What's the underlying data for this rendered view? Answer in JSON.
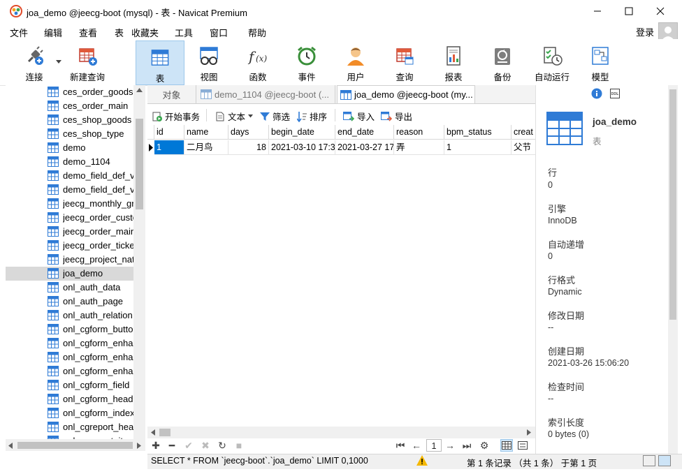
{
  "window": {
    "title": "joa_demo @jeecg-boot (mysql) - 表 - Navicat Premium",
    "min_icon": "minimize-icon",
    "max_icon": "maximize-icon",
    "close_icon": "close-icon"
  },
  "menu": {
    "items": [
      "文件",
      "编辑",
      "查看",
      "表",
      "收藏夹",
      "工具",
      "窗口",
      "帮助"
    ],
    "login": "登录"
  },
  "toolbar": {
    "buttons": [
      {
        "label": "连接",
        "icon": "plug-icon"
      },
      {
        "label": "新建查询",
        "icon": "new-query-icon"
      },
      {
        "label": "表",
        "icon": "table-icon"
      },
      {
        "label": "视图",
        "icon": "view-glasses-icon"
      },
      {
        "label": "函数",
        "icon": "function-icon"
      },
      {
        "label": "事件",
        "icon": "alarm-clock-icon"
      },
      {
        "label": "用户",
        "icon": "user-icon"
      },
      {
        "label": "查询",
        "icon": "query-grid-icon"
      },
      {
        "label": "报表",
        "icon": "report-icon"
      },
      {
        "label": "备份",
        "icon": "backup-icon"
      },
      {
        "label": "自动运行",
        "icon": "schedule-icon"
      },
      {
        "label": "模型",
        "icon": "model-icon"
      }
    ],
    "active_index": 2
  },
  "tree": {
    "items": [
      "ces_order_goods",
      "ces_order_main",
      "ces_shop_goods",
      "ces_shop_type",
      "demo",
      "demo_1104",
      "demo_field_def_va",
      "demo_field_def_v",
      "jeecg_monthly_gr",
      "jeecg_order_custo",
      "jeecg_order_main",
      "jeecg_order_ticke",
      "jeecg_project_nat",
      "joa_demo",
      "onl_auth_data",
      "onl_auth_page",
      "onl_auth_relation",
      "onl_cgform_butto",
      "onl_cgform_enhar",
      "onl_cgform_enhar",
      "onl_cgform_enhar",
      "onl_cgform_field",
      "onl_cgform_head",
      "onl_cgform_index",
      "onl_cgreport_hea",
      "onl_cgreport_item"
    ],
    "selected_index": 13
  },
  "tabs": [
    {
      "label": "对象"
    },
    {
      "label": "demo_1104 @jeecg-boot (..."
    },
    {
      "label": "joa_demo @jeecg-boot (my..."
    }
  ],
  "datatools": {
    "begin_tx": "开始事务",
    "text": "文本",
    "filter": "筛选",
    "sort": "排序",
    "import": "导入",
    "export": "导出"
  },
  "grid": {
    "columns": [
      "id",
      "name",
      "days",
      "begin_date",
      "end_date",
      "reason",
      "bpm_status",
      "creat"
    ],
    "rows": [
      [
        "1",
        "二月鸟",
        "18",
        "2021-03-10 17:3",
        "2021-03-27 17",
        "弄",
        "1",
        "父节"
      ]
    ]
  },
  "nav": {
    "page": "1"
  },
  "status": {
    "sql": "SELECT * FROM `jeecg-boot`.`joa_demo` LIMIT 0,1000",
    "records": "第 1 条记录 （共 1 条） 于第 1 页"
  },
  "info": {
    "name": "joa_demo",
    "type": "表",
    "fields": [
      {
        "label": "行",
        "value": "0"
      },
      {
        "label": "引擎",
        "value": "InnoDB"
      },
      {
        "label": "自动递增",
        "value": "0"
      },
      {
        "label": "行格式",
        "value": "Dynamic"
      },
      {
        "label": "修改日期",
        "value": "--"
      },
      {
        "label": "创建日期",
        "value": "2021-03-26 15:06:20"
      },
      {
        "label": "检查时间",
        "value": "--"
      },
      {
        "label": "索引长度",
        "value": "0 bytes (0)"
      }
    ]
  },
  "colors": {
    "accent": "#2f7bd6",
    "active_tab_bg": "#cde4f7",
    "selected_cell": "#0078d7"
  }
}
